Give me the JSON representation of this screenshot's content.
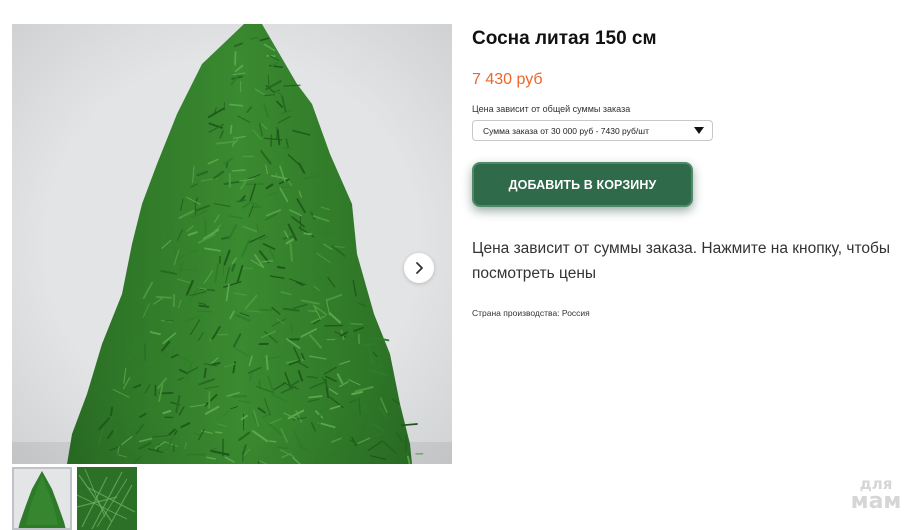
{
  "product": {
    "title": "Сосна литая 150 см",
    "price": "7 430 руб",
    "price_note": "Цена зависит от общей суммы заказа",
    "tier_select": {
      "selected": "Сумма заказа от 30 000 руб - 7430 руб/шт"
    },
    "add_to_cart_label": "ДОБАВИТЬ В КОРЗИНУ",
    "description": "Цена зависит от суммы заказа. Нажмите на кнопку, чтобы посмотреть цены",
    "country": "Страна производства: Россия"
  },
  "gallery": {
    "main_image": "artificial-pine-tree",
    "next_icon": "chevron-right-icon",
    "thumbnails": [
      {
        "image": "pine-tree-full",
        "active": true
      },
      {
        "image": "pine-needles-closeup",
        "active": false
      }
    ]
  },
  "watermark": {
    "line1": "для",
    "line2": "мам"
  },
  "colors": {
    "price": "#f0652a",
    "button": "#2f6a4b",
    "tree": "#2d7a2a"
  }
}
